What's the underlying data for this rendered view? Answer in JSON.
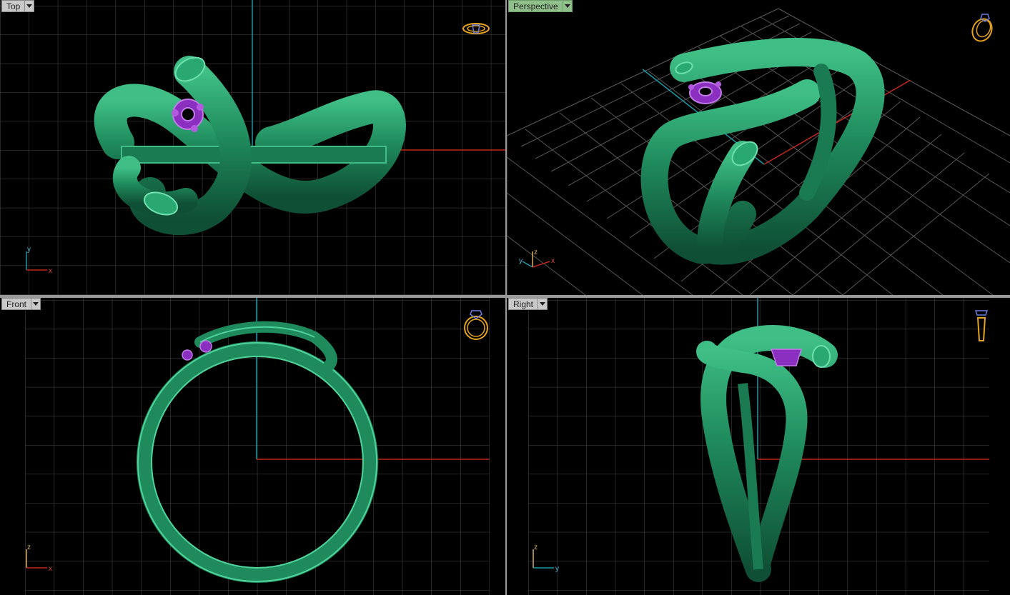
{
  "viewports": {
    "top": {
      "label": "Top",
      "axis1": "y",
      "axis2": "x"
    },
    "perspective": {
      "label": "Perspective",
      "axis1": "y",
      "axis2": "z",
      "axis3": "x"
    },
    "front": {
      "label": "Front",
      "axis1": "z",
      "axis2": "x"
    },
    "right": {
      "label": "Right",
      "axis1": "z",
      "axis2": "y"
    }
  },
  "colors": {
    "background": "#000000",
    "grid": "#4a4a4a",
    "x_axis": "#c0281c",
    "y_axis": "#1a9aa8",
    "ring_body": "#1f8a5c",
    "ring_highlight": "#4fd39a",
    "gem": "#9a3ac8",
    "active_tab": "#8fbf8a",
    "icon": "#e6a41c"
  },
  "icons": {
    "top": "ring-top-view-icon",
    "perspective": "ring-perspective-icon",
    "front": "ring-front-view-icon",
    "right": "ring-side-view-icon"
  }
}
